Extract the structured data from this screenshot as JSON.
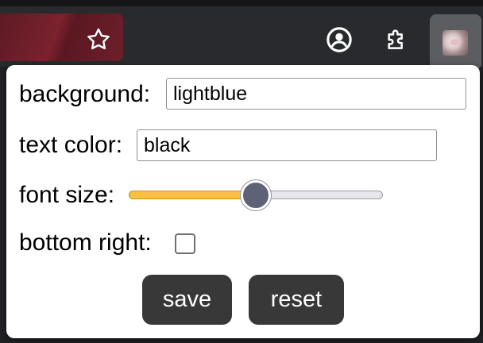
{
  "browser": {
    "toolbar_icons": [
      "star-icon",
      "account-icon",
      "puzzle-icon"
    ],
    "extension_icon": "cat-avatar"
  },
  "popup": {
    "background_label": "background:",
    "background_value": "lightblue",
    "text_color_label": "text color:",
    "text_color_value": "black",
    "font_size_label": "font size:",
    "font_size_fraction": 0.5,
    "bottom_right_label": "bottom right:",
    "bottom_right_checked": false,
    "save_label": "save",
    "reset_label": "reset"
  },
  "colors": {
    "slider_fill": "#fbc041",
    "slider_thumb": "#5e6276",
    "button_bg": "#383838",
    "address_bar": "#6e1f2a"
  }
}
